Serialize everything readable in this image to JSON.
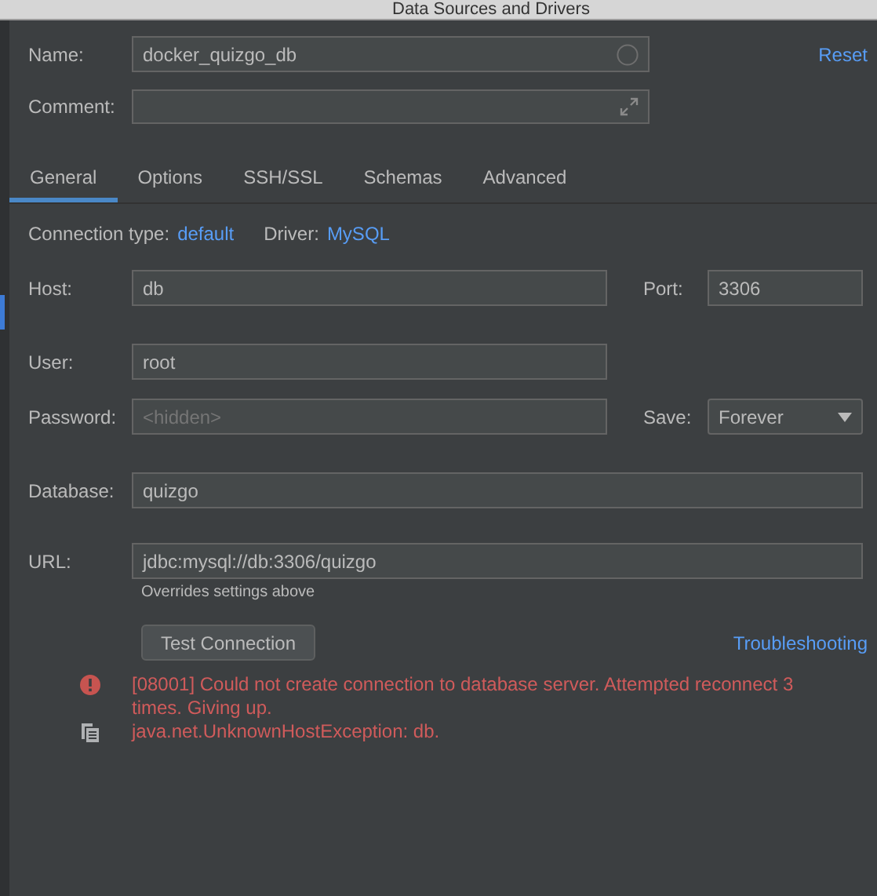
{
  "window": {
    "title": "Data Sources and Drivers"
  },
  "name": {
    "label": "Name:",
    "value": "docker_quizgo_db"
  },
  "comment": {
    "label": "Comment:"
  },
  "reset_link": "Reset",
  "tabs": [
    {
      "label": "General",
      "selected": true
    },
    {
      "label": "Options",
      "selected": false
    },
    {
      "label": "SSH/SSL",
      "selected": false
    },
    {
      "label": "Schemas",
      "selected": false
    },
    {
      "label": "Advanced",
      "selected": false
    }
  ],
  "connection_type": {
    "label": "Connection type:",
    "value": "default"
  },
  "driver": {
    "label": "Driver:",
    "value": "MySQL"
  },
  "host": {
    "label": "Host:",
    "value": "db"
  },
  "port": {
    "label": "Port:",
    "value": "3306"
  },
  "user": {
    "label": "User:",
    "value": "root"
  },
  "password": {
    "label": "Password:",
    "placeholder": "<hidden>"
  },
  "save": {
    "label": "Save:",
    "value": "Forever"
  },
  "database": {
    "label": "Database:",
    "value": "quizgo"
  },
  "url": {
    "label": "URL:",
    "value": "jdbc:mysql://db:3306/quizgo",
    "hint": "Overrides settings above"
  },
  "test_button": "Test Connection",
  "troubleshooting_link": "Troubleshooting",
  "messages": [
    {
      "kind": "error",
      "text": "[08001] Could not create connection to database server. Attempted reconnect 3 times. Giving up."
    },
    {
      "kind": "copy",
      "text": "java.net.UnknownHostException: db."
    }
  ]
}
